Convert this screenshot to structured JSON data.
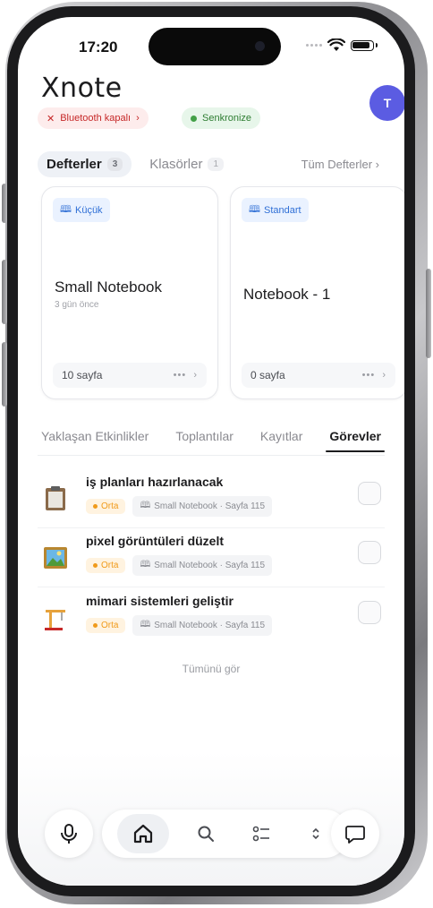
{
  "status_bar": {
    "time": "17:20"
  },
  "header": {
    "logo": "Xnote",
    "avatar_initial": "T",
    "bluetooth_label": "Bluetooth kapalı",
    "bluetooth_chevron": "›",
    "sync_label": "Senkronize"
  },
  "tabs": {
    "notebooks_label": "Defterler",
    "notebooks_count": "3",
    "folders_label": "Klasörler",
    "folders_count": "1",
    "all_notebooks": "Tüm Defterler ›"
  },
  "notebooks": [
    {
      "type": "Küçük",
      "title": "Small Notebook",
      "subtitle": "3 gün önce",
      "pages": "10 sayfa"
    },
    {
      "type": "Standart",
      "title": "Notebook - 1",
      "subtitle": "",
      "pages": "0 sayfa"
    }
  ],
  "segments": {
    "events": "Yaklaşan Etkinlikler",
    "meetings": "Toplantılar",
    "recordings": "Kayıtlar",
    "tasks": "Görevler"
  },
  "tasks": [
    {
      "title": "iş planları hazırlanacak",
      "priority": "Orta",
      "location": "Small Notebook · Sayfa 115",
      "icon": "clipboard-icon"
    },
    {
      "title": "pixel görüntüleri düzelt",
      "priority": "Orta",
      "location": "Small Notebook · Sayfa 115",
      "icon": "picture-icon"
    },
    {
      "title": "mimari sistemleri geliştir",
      "priority": "Orta",
      "location": "Small Notebook · Sayfa 115",
      "icon": "crane-icon"
    }
  ],
  "see_all": "Tümünü gör",
  "colors": {
    "accent": "#5b5ce2",
    "bluetooth_off": "#c62828",
    "sync_ok": "#2e7d32",
    "priority_medium": "#f09a1a",
    "tag_blue": "#2f6fd6"
  }
}
